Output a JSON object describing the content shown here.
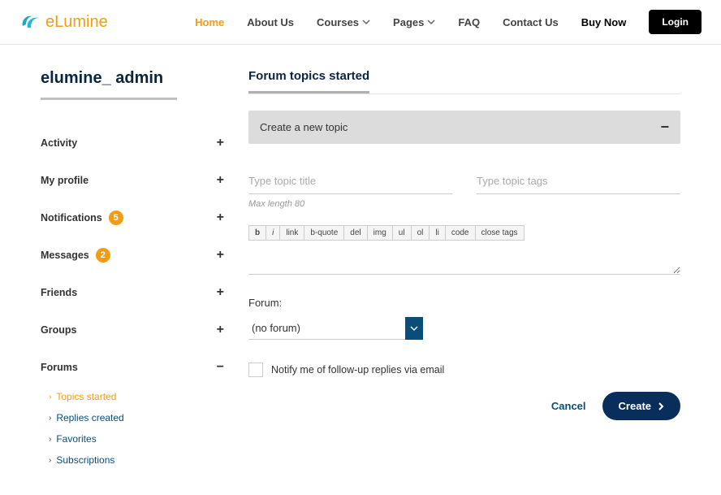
{
  "logo": {
    "text": "eLumine"
  },
  "nav": {
    "home": "Home",
    "about": "About Us",
    "courses": "Courses",
    "pages": "Pages",
    "faq": "FAQ",
    "contact": "Contact Us",
    "buy": "Buy Now",
    "login": "Login"
  },
  "username": "elumine_ admin",
  "sidebar": {
    "activity": "Activity",
    "my_profile": "My profile",
    "notifications": "Notifications",
    "notifications_count": "5",
    "messages": "Messages",
    "messages_count": "2",
    "friends": "Friends",
    "groups": "Groups",
    "forums": "Forums",
    "plus": "+",
    "minus": "−",
    "sub": {
      "topics_started": "Topics started",
      "replies_created": "Replies created",
      "favorites": "Favorites",
      "subscriptions": "Subscriptions"
    }
  },
  "section": {
    "title": "Forum topics started",
    "accordion_label": "Create a new topic",
    "title_placeholder": "Type topic title",
    "tags_placeholder": "Type topic tags",
    "hint": "Max length 80",
    "toolbar": {
      "b": "b",
      "i": "i",
      "link": "link",
      "bquote": "b-quote",
      "del": "del",
      "img": "img",
      "ul": "ul",
      "ol": "ol",
      "li": "li",
      "code": "code",
      "close": "close tags"
    },
    "forum_label": "Forum:",
    "forum_selected": "(no forum)",
    "notify_label": "Notify me of follow-up replies via email",
    "cancel": "Cancel",
    "create": "Create"
  }
}
